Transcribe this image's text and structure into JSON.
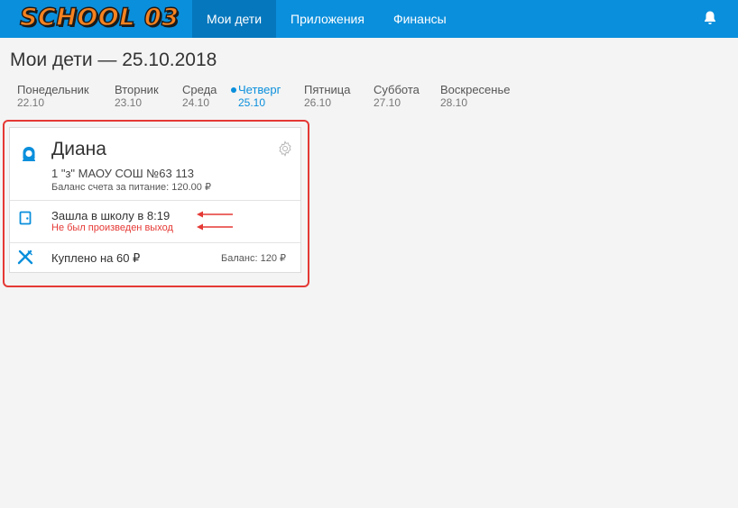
{
  "header": {
    "logo_text": "SCHOOL 03",
    "nav": [
      {
        "label": "Мои дети",
        "active": true
      },
      {
        "label": "Приложения",
        "active": false
      },
      {
        "label": "Финансы",
        "active": false
      }
    ],
    "bell_icon": "bell-icon"
  },
  "page": {
    "title": "Мои дети — 25.10.2018"
  },
  "days": [
    {
      "name": "Понедельник",
      "date": "22.10",
      "active": false
    },
    {
      "name": "Вторник",
      "date": "23.10",
      "active": false
    },
    {
      "name": "Среда",
      "date": "24.10",
      "active": false
    },
    {
      "name": "Четверг",
      "date": "25.10",
      "active": true
    },
    {
      "name": "Пятница",
      "date": "26.10",
      "active": false
    },
    {
      "name": "Суббота",
      "date": "27.10",
      "active": false
    },
    {
      "name": "Воскресенье",
      "date": "28.10",
      "active": false
    }
  ],
  "child": {
    "name": "Диана",
    "school": "1 \"з\" МАОУ СОШ №63 113",
    "meal_balance": "Баланс счета за питание: 120.00 ₽",
    "entry": "Зашла в школу в 8:19",
    "exit_status": "Не был произведен выход",
    "purchase": "Куплено на 60 ₽",
    "balance": "Баланс: 120 ₽"
  },
  "colors": {
    "primary": "#0a8fdc",
    "active_nav": "#0577bd",
    "alert": "#e53935",
    "logo": "#f58220"
  }
}
